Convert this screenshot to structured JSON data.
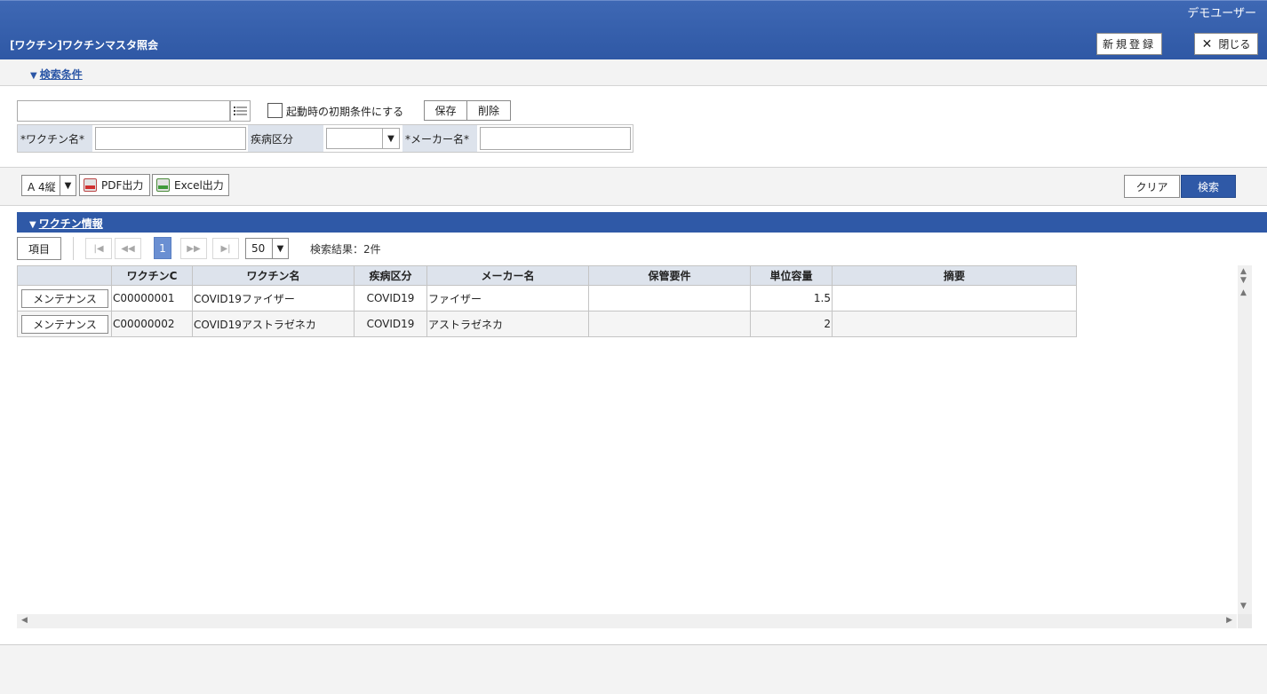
{
  "header": {
    "user": "デモユーザー",
    "title": "[ワクチン]ワクチンマスタ照会",
    "new_label": "新規登録",
    "close_label": "閉じる"
  },
  "search": {
    "toggle_label": "検索条件",
    "preset_value": "",
    "default_checkbox_label": "起動時の初期条件にする",
    "default_checked": false,
    "save_label": "保存",
    "delete_label": "削除",
    "vaccine_name_label": "*ワクチン名*",
    "vaccine_name_value": "",
    "disease_label": "疾病区分",
    "disease_value": "",
    "maker_label": "*メーカー名*",
    "maker_value": ""
  },
  "toolbar": {
    "paper_value": "A 4縦",
    "pdf_label": "PDF出力",
    "excel_label": "Excel出力",
    "clear_label": "クリア",
    "search_label": "検索"
  },
  "results": {
    "section_label": "ワクチン情報",
    "items_label": "項目",
    "current_page": "1",
    "page_size": "50",
    "result_text": "検索結果：2件",
    "columns": [
      "",
      "ワクチンC",
      "ワクチン名",
      "疾病区分",
      "メーカー名",
      "保管要件",
      "単位容量",
      "摘要"
    ],
    "rows": [
      {
        "action": "メンテナンス",
        "code": "C00000001",
        "name": "COVID19ファイザー",
        "disease": "COVID19",
        "maker": "ファイザー",
        "storage": "",
        "unit": "1.5",
        "note": ""
      },
      {
        "action": "メンテナンス",
        "code": "C00000002",
        "name": "COVID19アストラゼネカ",
        "disease": "COVID19",
        "maker": "アストラゼネカ",
        "storage": "",
        "unit": "2",
        "note": ""
      }
    ]
  },
  "colors": {
    "header_blue": "#2f58a5",
    "section_blue": "#2f59a7",
    "label_bg": "#dde3ec",
    "link_blue": "#2b56a6"
  },
  "icons": {
    "preset_list": "list-icon",
    "pdf": "pdf-file-icon",
    "excel": "excel-file-icon",
    "close": "close-icon",
    "section_toggle": "triangle-down-icon"
  }
}
